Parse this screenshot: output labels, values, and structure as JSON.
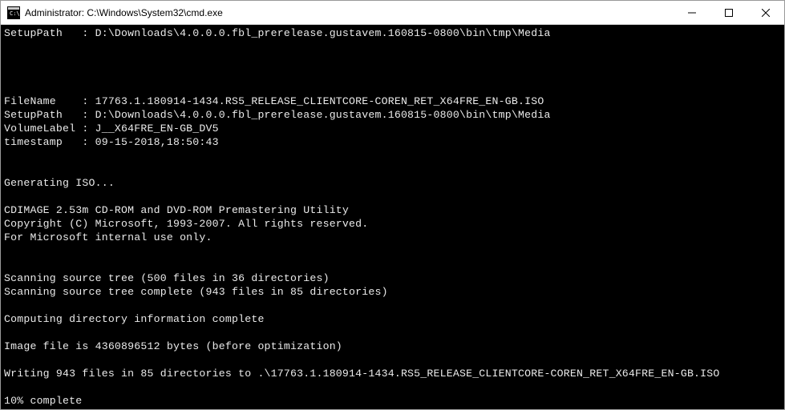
{
  "window": {
    "title": "Administrator: C:\\Windows\\System32\\cmd.exe"
  },
  "lines": {
    "l0": "SetupPath   : D:\\Downloads\\4.0.0.0.fbl_prerelease.gustavem.160815-0800\\bin\\tmp\\Media",
    "l1": "",
    "l2": "",
    "l3": "",
    "l4": "",
    "l5": "FileName    : 17763.1.180914-1434.RS5_RELEASE_CLIENTCORE-COREN_RET_X64FRE_EN-GB.ISO",
    "l6": "SetupPath   : D:\\Downloads\\4.0.0.0.fbl_prerelease.gustavem.160815-0800\\bin\\tmp\\Media",
    "l7": "VolumeLabel : J__X64FRE_EN-GB_DV5",
    "l8": "timestamp   : 09-15-2018,18:50:43",
    "l9": "",
    "l10": "",
    "l11": "Generating ISO...",
    "l12": "",
    "l13": "CDIMAGE 2.53m CD-ROM and DVD-ROM Premastering Utility",
    "l14": "Copyright (C) Microsoft, 1993-2007. All rights reserved.",
    "l15": "For Microsoft internal use only.",
    "l16": "",
    "l17": "",
    "l18": "Scanning source tree (500 files in 36 directories)",
    "l19": "Scanning source tree complete (943 files in 85 directories)",
    "l20": "",
    "l21": "Computing directory information complete",
    "l22": "",
    "l23": "Image file is 4360896512 bytes (before optimization)",
    "l24": "",
    "l25": "Writing 943 files in 85 directories to .\\17763.1.180914-1434.RS5_RELEASE_CLIENTCORE-COREN_RET_X64FRE_EN-GB.ISO",
    "l26": "",
    "l27": "10% complete"
  }
}
